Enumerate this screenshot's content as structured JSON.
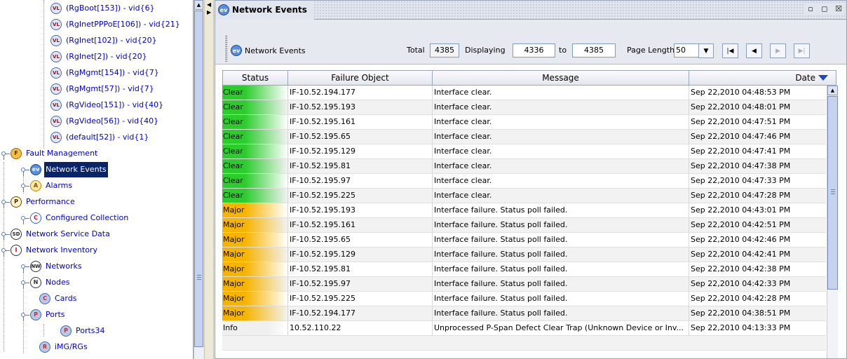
{
  "tree": {
    "items": [
      {
        "label": "(RgBoot[153]) - vid{6}",
        "icon": "vlan-icon"
      },
      {
        "label": "(RgInetPPPoE[106]) - vid{21}",
        "icon": "vlan-icon"
      },
      {
        "label": "(RgInet[102]) - vid{20}",
        "icon": "vlan-icon"
      },
      {
        "label": "(RgInet[2]) - vid{20}",
        "icon": "vlan-icon"
      },
      {
        "label": "(RgMgmt[154]) - vid{7}",
        "icon": "vlan-icon"
      },
      {
        "label": "(RgMgmt[57]) - vid{7}",
        "icon": "vlan-icon"
      },
      {
        "label": "(RgVideo[151]) - vid{40}",
        "icon": "vlan-icon"
      },
      {
        "label": "(RgVideo[56]) - vid{40}",
        "icon": "vlan-icon"
      },
      {
        "label": "(default[52]) - vid{1}",
        "icon": "vlan-icon"
      },
      {
        "label": "Fault Management",
        "icon": "fault-management-icon"
      },
      {
        "label": "Network Events",
        "icon": "network-events-icon",
        "selected": true
      },
      {
        "label": "Alarms",
        "icon": "alarms-icon"
      },
      {
        "label": "Performance",
        "icon": "performance-icon"
      },
      {
        "label": "Configured Collection",
        "icon": "collection-icon"
      },
      {
        "label": "Network Service Data",
        "icon": "service-data-icon"
      },
      {
        "label": "Network Inventory",
        "icon": "inventory-icon"
      },
      {
        "label": "Networks",
        "icon": "networks-icon"
      },
      {
        "label": "Nodes",
        "icon": "nodes-icon"
      },
      {
        "label": "Cards",
        "icon": "cards-icon"
      },
      {
        "label": "Ports",
        "icon": "ports-icon"
      },
      {
        "label": "Ports34",
        "icon": "ports-icon"
      },
      {
        "label": "iMG/RGs",
        "icon": "img-rgs-icon"
      }
    ]
  },
  "panel": {
    "title": "Network Events",
    "toolbar_name": "Network Events",
    "total_label": "Total",
    "total_value": "4385",
    "displaying_label": "Displaying",
    "from_value": "4336",
    "to_label": "to",
    "to_value": "4385",
    "page_length_label": "Page Length",
    "page_length_value": "50"
  },
  "table": {
    "columns": [
      "Status",
      "Failure Object",
      "Message",
      "Date"
    ],
    "sort_column": "Date",
    "rows": [
      {
        "status": "Clear",
        "object": "IF-10.52.194.177",
        "message": "Interface clear.",
        "date": "Sep 22,2010 04:48:53 PM"
      },
      {
        "status": "Clear",
        "object": "IF-10.52.195.193",
        "message": "Interface clear.",
        "date": "Sep 22,2010 04:48:01 PM"
      },
      {
        "status": "Clear",
        "object": "IF-10.52.195.161",
        "message": "Interface clear.",
        "date": "Sep 22,2010 04:47:51 PM"
      },
      {
        "status": "Clear",
        "object": "IF-10.52.195.65",
        "message": "Interface clear.",
        "date": "Sep 22,2010 04:47:46 PM"
      },
      {
        "status": "Clear",
        "object": "IF-10.52.195.129",
        "message": "Interface clear.",
        "date": "Sep 22,2010 04:47:41 PM"
      },
      {
        "status": "Clear",
        "object": "IF-10.52.195.81",
        "message": "Interface clear.",
        "date": "Sep 22,2010 04:47:38 PM"
      },
      {
        "status": "Clear",
        "object": "IF-10.52.195.97",
        "message": "Interface clear.",
        "date": "Sep 22,2010 04:47:33 PM"
      },
      {
        "status": "Clear",
        "object": "IF-10.52.195.225",
        "message": "Interface clear.",
        "date": "Sep 22,2010 04:47:28 PM"
      },
      {
        "status": "Major",
        "object": "IF-10.52.195.193",
        "message": "Interface failure.  Status poll failed.",
        "date": "Sep 22,2010 04:43:01 PM"
      },
      {
        "status": "Major",
        "object": "IF-10.52.195.161",
        "message": "Interface failure.  Status poll failed.",
        "date": "Sep 22,2010 04:42:51 PM"
      },
      {
        "status": "Major",
        "object": "IF-10.52.195.65",
        "message": "Interface failure.  Status poll failed.",
        "date": "Sep 22,2010 04:42:46 PM"
      },
      {
        "status": "Major",
        "object": "IF-10.52.195.129",
        "message": "Interface failure.  Status poll failed.",
        "date": "Sep 22,2010 04:42:41 PM"
      },
      {
        "status": "Major",
        "object": "IF-10.52.195.81",
        "message": "Interface failure.  Status poll failed.",
        "date": "Sep 22,2010 04:42:38 PM"
      },
      {
        "status": "Major",
        "object": "IF-10.52.195.97",
        "message": "Interface failure.  Status poll failed.",
        "date": "Sep 22,2010 04:42:33 PM"
      },
      {
        "status": "Major",
        "object": "IF-10.52.195.225",
        "message": "Interface failure.  Status poll failed.",
        "date": "Sep 22,2010 04:42:28 PM"
      },
      {
        "status": "Major",
        "object": "IF-10.52.194.177",
        "message": "Interface failure.  Status poll failed.",
        "date": "Sep 22,2010 04:38:51 PM"
      },
      {
        "status": "Info",
        "object": "10.52.110.22",
        "message": "Unprocessed P-Span Defect Clear Trap (Unknown Device or Inv...",
        "date": "Sep 22,2010 04:13:33 PM"
      }
    ]
  },
  "colors": {
    "clear": "#2dcc2d",
    "major": "#f5b400",
    "info": "#ffffff",
    "selection": "#0a246a",
    "link": "#0000cc"
  }
}
